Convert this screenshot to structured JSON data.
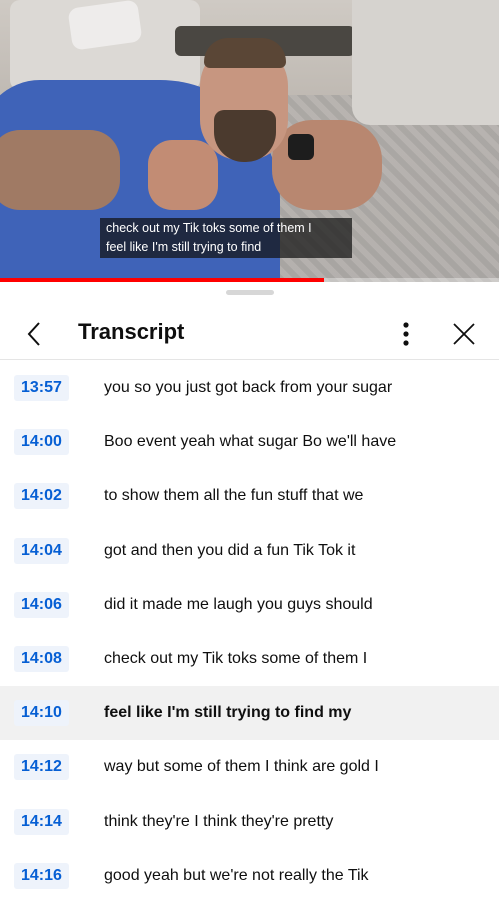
{
  "video": {
    "caption_line1": "check out my Tik toks some of them I",
    "caption_line2": "feel like I'm still trying to find",
    "progress": 0.65,
    "accent_color": "#ff0000"
  },
  "panel": {
    "title": "Transcript",
    "back_icon": "chevron-left-icon",
    "more_icon": "more-vertical-icon",
    "close_icon": "close-icon"
  },
  "transcript": [
    {
      "time": "13:57",
      "text": "you so you just got back from your sugar",
      "active": false
    },
    {
      "time": "14:00",
      "text": "Boo event yeah what sugar Bo we'll have",
      "active": false
    },
    {
      "time": "14:02",
      "text": "to show them all the fun stuff that we",
      "active": false
    },
    {
      "time": "14:04",
      "text": "got and then you did a fun Tik Tok it",
      "active": false
    },
    {
      "time": "14:06",
      "text": "did it made me laugh you guys should",
      "active": false
    },
    {
      "time": "14:08",
      "text": "check out my Tik toks some of them I",
      "active": false
    },
    {
      "time": "14:10",
      "text": "feel like I'm still trying to find my",
      "active": true
    },
    {
      "time": "14:12",
      "text": "way but some of them I think are gold I",
      "active": false
    },
    {
      "time": "14:14",
      "text": "think they're I think they're pretty",
      "active": false
    },
    {
      "time": "14:16",
      "text": "good yeah but we're not really the Tik",
      "active": false
    }
  ]
}
